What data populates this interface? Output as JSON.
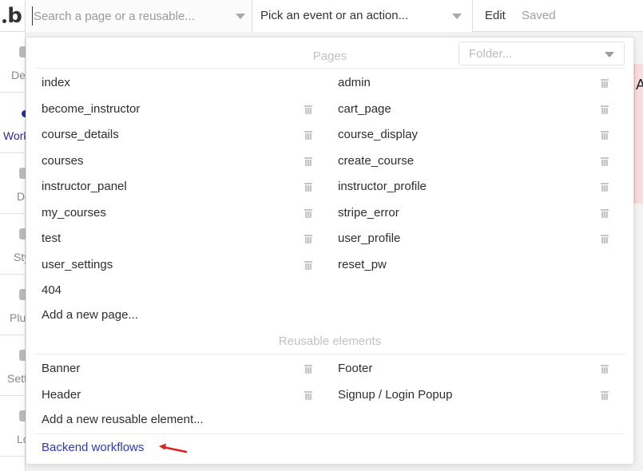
{
  "topbar": {
    "logo_letter": "b",
    "page_search_placeholder": "Search a page or a reusable...",
    "event_select_label": "Pick an event or an action...",
    "edit_label": "Edit",
    "saved_label": "Saved"
  },
  "sidebar": {
    "items": [
      {
        "label": "Design"
      },
      {
        "label": "Workflow"
      },
      {
        "label": "Data"
      },
      {
        "label": "Styles"
      },
      {
        "label": "Plugins"
      },
      {
        "label": "Settings"
      },
      {
        "label": "Logs"
      }
    ]
  },
  "dropdown": {
    "folder_placeholder": "Folder...",
    "pages_title": "Pages",
    "pages_left": [
      "index",
      "become_instructor",
      "course_details",
      "courses",
      "instructor_panel",
      "my_courses",
      "test",
      "user_settings",
      "404"
    ],
    "pages_right": [
      "admin",
      "cart_page",
      "course_display",
      "create_course",
      "instructor_profile",
      "stripe_error",
      "user_profile",
      "reset_pw"
    ],
    "add_page_label": "Add a new page...",
    "reusable_title": "Reusable elements",
    "reusable_left": [
      "Banner",
      "Header"
    ],
    "reusable_right": [
      "Footer",
      "Signup / Login Popup"
    ],
    "add_reusable_label": "Add a new reusable element...",
    "backend_workflows_label": "Backend workflows"
  },
  "canvas": {
    "visible_letter": "A"
  },
  "colors": {
    "link": "#3236b8",
    "annotation_arrow": "#e02020",
    "section_title": "#c2c2c2"
  }
}
